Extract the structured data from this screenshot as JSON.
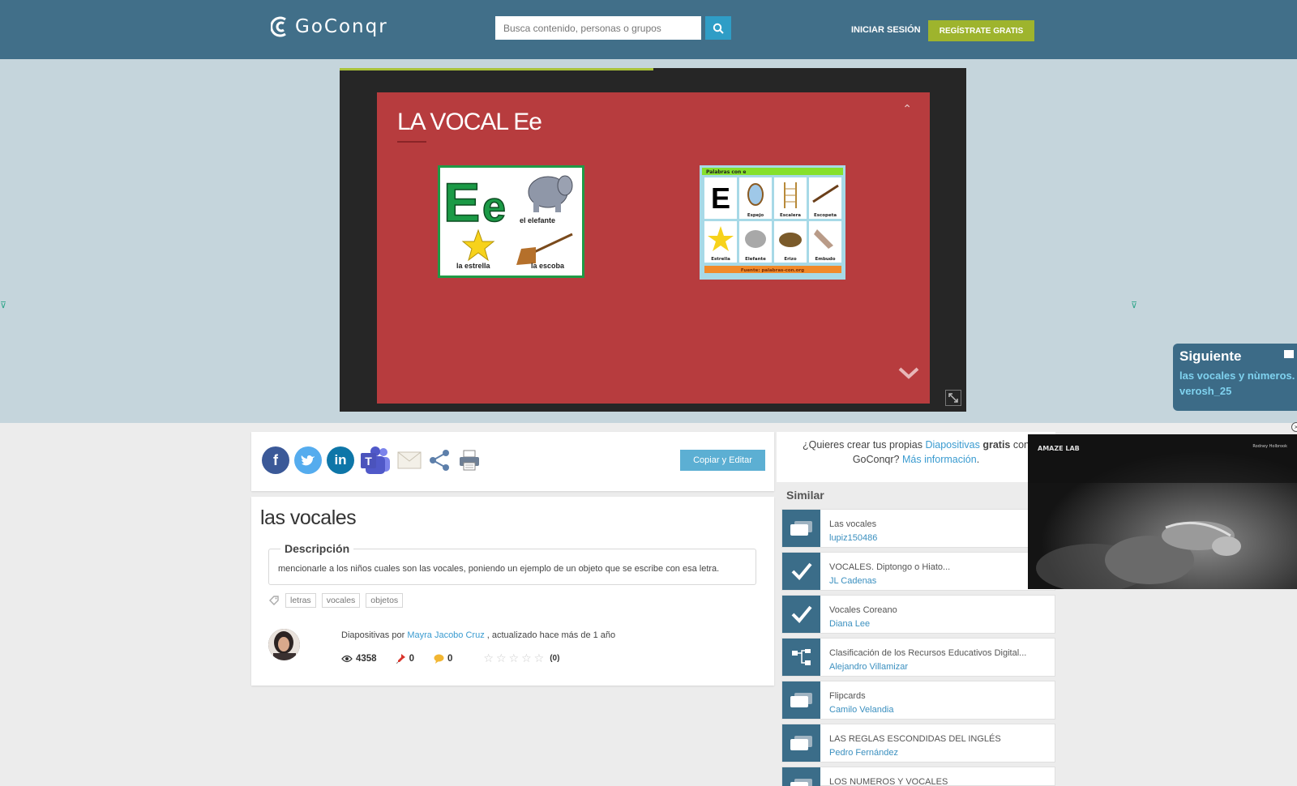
{
  "header": {
    "logo_text": "GoConqr",
    "search_placeholder": "Busca contenido, personas o grupos",
    "login_label": "INICIAR SESIÓN",
    "signup_label": "REGÍSTRATE GRATIS"
  },
  "viewer": {
    "slide_title": "LA VOCAL Ee",
    "progress_fraction": 0.5,
    "image1": {
      "big_letters": "Ee",
      "word_elefante": "el elefante",
      "word_estrella": "la estrella",
      "word_escoba": "la escoba"
    },
    "image2": {
      "header": "Palabras con e",
      "cells": [
        "E",
        "Espejo",
        "Escalera",
        "Escopeta",
        "Estrella",
        "Elefante",
        "Erizo",
        "Embudo"
      ],
      "footer": "Fuente: palabras-con.org"
    }
  },
  "next_box": {
    "title": "Siguiente",
    "item_title": "las vocales y nùmeros.",
    "item_author": "verosh_25"
  },
  "share": {
    "icons": [
      "facebook-icon",
      "twitter-icon",
      "linkedin-icon",
      "teams-icon",
      "email-icon",
      "share-icon",
      "print-icon"
    ],
    "copy_edit_label": "Copiar y Editar"
  },
  "resource": {
    "title": "las vocales",
    "description_label": "Descripción",
    "description": "mencionarle a los niños cuales son las vocales, poniendo un ejemplo de un objeto que se escribe con esa letra.",
    "tags": [
      "letras",
      "vocales",
      "objetos"
    ],
    "meta_prefix": "Diapositivas por",
    "author": "Mayra Jacobo Cruz",
    "meta_suffix": ", actualizado hace más de 1 año",
    "views": "4358",
    "pins": "0",
    "comments": "0",
    "rating_count": "(0)",
    "rating_value": 0
  },
  "promo": {
    "prefix": "¿Quieres crear tus propias",
    "link_type": "Diapositivas",
    "bold_word": "gratis",
    "middle": "con GoConqr?",
    "more_link": "Más información",
    "end": "."
  },
  "similar": {
    "title": "Similar",
    "items": [
      {
        "title": "Las vocales",
        "author": "lupiz150486",
        "icon": "slides-icon"
      },
      {
        "title": "VOCALES. Diptongo o Hiato...",
        "author": "JL Cadenas",
        "icon": "quiz-check-icon"
      },
      {
        "title": "Vocales Coreano",
        "author": "Diana Lee",
        "icon": "quiz-check-icon"
      },
      {
        "title": "Clasificación de los Recursos Educativos Digital...",
        "author": "Alejandro Villamizar",
        "icon": "mindmap-icon"
      },
      {
        "title": "Flipcards",
        "author": "Camilo Velandia",
        "icon": "slides-icon"
      },
      {
        "title": "LAS REGLAS ESCONDIDAS DEL INGLÉS",
        "author": "Pedro Fernández",
        "icon": "slides-icon"
      },
      {
        "title": "LOS NUMEROS Y VOCALES",
        "author": "",
        "icon": "slides-icon"
      }
    ]
  },
  "video_ad": {
    "brand": "AMAZE LAB",
    "credit": "Rodney Holbrook",
    "close": "×"
  },
  "colors": {
    "header_bg": "#416f89",
    "band_bg": "#c5d5dc",
    "slide_bg": "#b73c3e",
    "signup_bg": "#9eb42d",
    "accent_blue": "#3a9bd0",
    "similar_icon_bg": "#3b6d89"
  }
}
